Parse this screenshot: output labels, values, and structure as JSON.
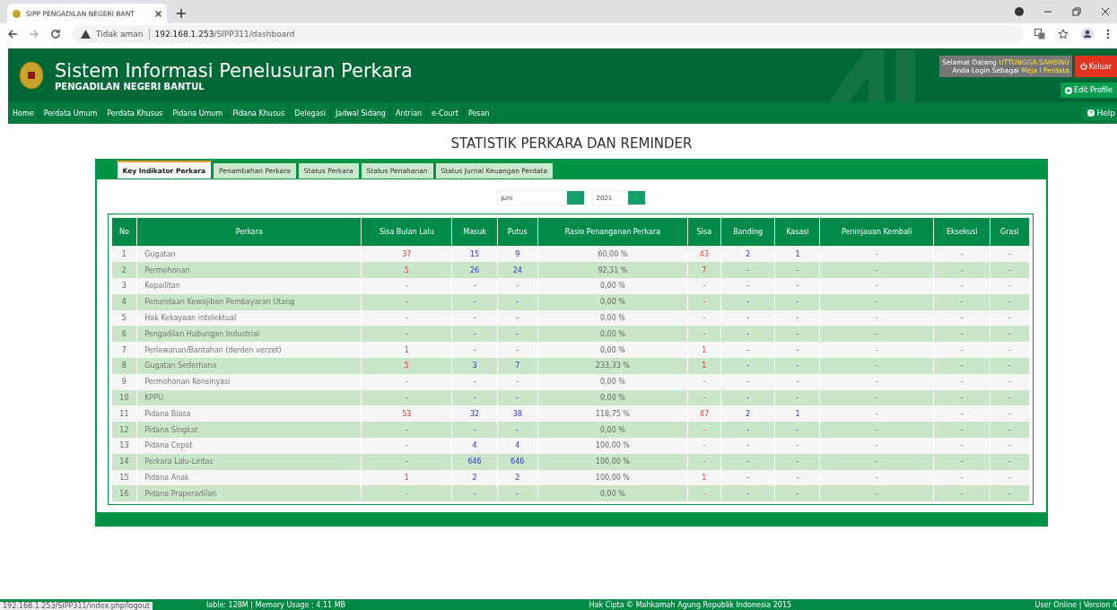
{
  "browser": {
    "tab_title": "SIPP PENGADILAN NEGERI BANT",
    "security": "Tidak aman",
    "url_host": "192.168.1.253",
    "url_path": "/SIPP311/dashboard"
  },
  "header": {
    "title": "Sistem Informasi Penelusuran Perkara",
    "subtitle": "PENGADILAN NEGERI BANTUL",
    "welcome_label": "Selamat Datang",
    "user": "UTTUNGGA SAHISNU",
    "login_label": "Anda Login Sebagai",
    "role": "Meja I Perdata",
    "logout": "Keluar",
    "edit_profile": "Edit Profile"
  },
  "nav": {
    "items": [
      "Home",
      "Perdata Umum",
      "Perdata Khusus",
      "Pidana Umum",
      "Pidana Khusus",
      "Delegasi",
      "Jadwal Sidang",
      "Antrian",
      "e-Court",
      "Pesan"
    ],
    "help": "Help"
  },
  "page_title": "STATISTIK PERKARA DAN REMINDER",
  "tabs": [
    {
      "label": "Key Indikator Perkara",
      "selected": true
    },
    {
      "label": "Penambahan Perkara",
      "selected": false
    },
    {
      "label": "Status Perkara",
      "selected": false
    },
    {
      "label": "Status Penahanan",
      "selected": false
    },
    {
      "label": "Status Jurnal Keuangan Perdata",
      "selected": false
    }
  ],
  "filters": {
    "month": "Juni",
    "year": "2021"
  },
  "table": {
    "columns": [
      {
        "label": "No"
      },
      {
        "label": "Perkara"
      },
      {
        "label": "Sisa Bulan Lalu",
        "kind": "remaining"
      },
      {
        "label": "Masuk",
        "kind": "flow"
      },
      {
        "label": "Putus",
        "kind": "flow"
      },
      {
        "label": "Rasio Penanganan Perkara"
      },
      {
        "label": "Sisa",
        "kind": "remaining"
      },
      {
        "label": "Banding",
        "kind": "flow"
      },
      {
        "label": "Kasasi",
        "kind": "flow"
      },
      {
        "label": "Peninjauan Kembali"
      },
      {
        "label": "Eksekusi"
      },
      {
        "label": "Grasi"
      }
    ],
    "rows": [
      [
        "1",
        "Gugatan",
        "37",
        "15",
        "9",
        "60,00 %",
        "43",
        "2",
        "1",
        "-",
        "-",
        "-"
      ],
      [
        "2",
        "Permohonan",
        "5",
        "26",
        "24",
        "92,31 %",
        "7",
        "-",
        "-",
        "-",
        "-",
        "-"
      ],
      [
        "3",
        "Kepailitan",
        "-",
        "-",
        "-",
        "0,00 %",
        "-",
        "-",
        "-",
        "-",
        "-",
        "-"
      ],
      [
        "4",
        "Penundaan Kewajiban Pembayaran Utang",
        "-",
        "-",
        "-",
        "0,00 %",
        "-",
        "-",
        "-",
        "-",
        "-",
        "-"
      ],
      [
        "5",
        "Hak Kekayaan intelektual",
        "-",
        "-",
        "-",
        "0,00 %",
        "-",
        "-",
        "-",
        "-",
        "-",
        "-"
      ],
      [
        "6",
        "Pengadilan Hubungan Industrial",
        "-",
        "-",
        "-",
        "0,00 %",
        "-",
        "-",
        "-",
        "-",
        "-",
        "-"
      ],
      [
        "7",
        "Perlawanan/Bantahan (derden verzet)",
        "1",
        "-",
        "-",
        "0,00 %",
        "1",
        "-",
        "-",
        "-",
        "-",
        "-"
      ],
      [
        "8",
        "Gugatan Sederhana",
        "5",
        "3",
        "7",
        "233,33 %",
        "1",
        "-",
        "-",
        "-",
        "-",
        "-"
      ],
      [
        "9",
        "Permohonan Konsinyasi",
        "-",
        "-",
        "-",
        "0,00 %",
        "-",
        "-",
        "-",
        "-",
        "-",
        "-"
      ],
      [
        "10",
        "KPPU",
        "-",
        "-",
        "-",
        "0,00 %",
        "-",
        "-",
        "-",
        "-",
        "-",
        "-"
      ],
      [
        "11",
        "Pidana Biasa",
        "53",
        "32",
        "38",
        "118,75 %",
        "47",
        "2",
        "1",
        "-",
        "-",
        "-"
      ],
      [
        "12",
        "Pidana Singkat",
        "-",
        "-",
        "-",
        "0,00 %",
        "-",
        "-",
        "-",
        "-",
        "-",
        "-"
      ],
      [
        "13",
        "Pidana Cepat",
        "-",
        "4",
        "4",
        "100,00 %",
        "-",
        "-",
        "-",
        "-",
        "-",
        "-"
      ],
      [
        "14",
        "Perkara Lalu-Lintas",
        "-",
        "646",
        "646",
        "100,00 %",
        "-",
        "-",
        "-",
        "-",
        "-",
        "-"
      ],
      [
        "15",
        "Pidana Anak",
        "1",
        "2",
        "2",
        "100,00 %",
        "1",
        "-",
        "-",
        "-",
        "-",
        "-"
      ],
      [
        "16",
        "Pidana Praperadilan",
        "-",
        "-",
        "-",
        "0,00 %",
        "-",
        "-",
        "-",
        "-",
        "-",
        "-"
      ]
    ]
  },
  "footer": {
    "left": "lable: 128M | Memory Usage : 4.11 MB",
    "center": "Hak Cipta © Mahkamah Agung Republik Indonesia 2015",
    "right": "User Online | Version 4"
  },
  "status_link": "192.168.1.253/SIPP311/index.php/logout"
}
